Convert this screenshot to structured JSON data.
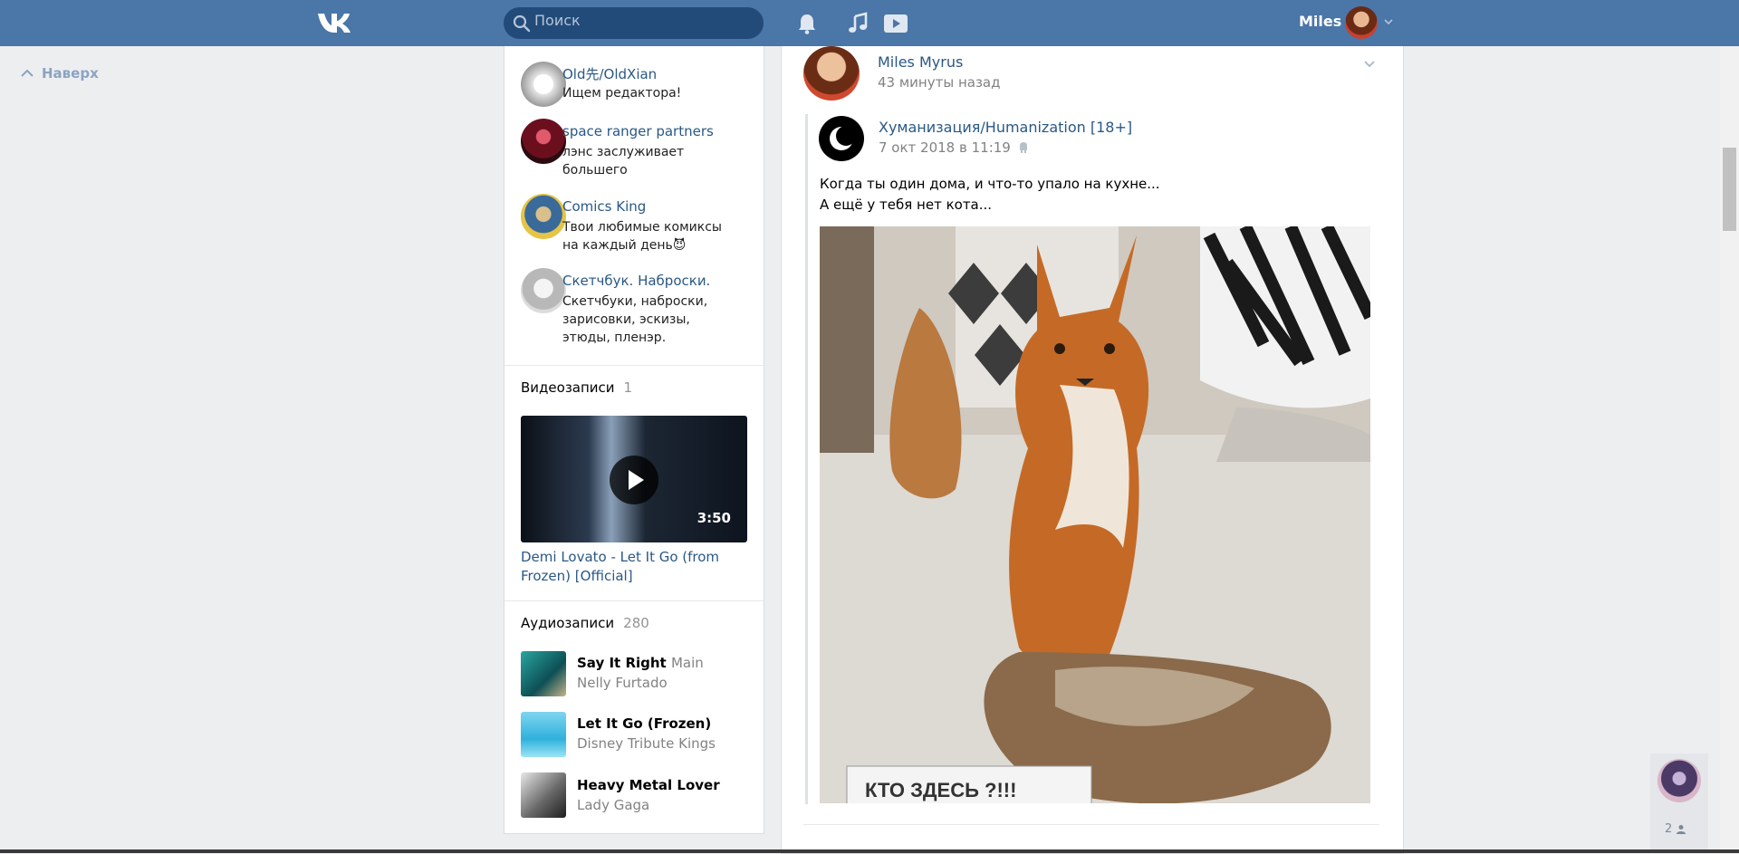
{
  "header": {
    "search_placeholder": "Поиск",
    "user_name": "Miles"
  },
  "sidebar_link": {
    "up_label": "Наверх"
  },
  "groups": [
    {
      "title": "Old先/OldXian",
      "desc": "Ищем редактора!"
    },
    {
      "title": "space ranger partners",
      "desc": "лэнс заслуживает большего"
    },
    {
      "title": "Comics King",
      "desc": "Твои любимые комиксы на каждый день😈"
    },
    {
      "title": "Скетчбук. Наброски.",
      "desc": "Скетчбуки, наброски, зарисовки, эскизы, этюды, пленэр."
    }
  ],
  "videos": {
    "title": "Видеозаписи",
    "count": "1",
    "item": {
      "duration": "3:50",
      "title": "Demi Lovato - Let It Go (from Frozen) [Official]"
    }
  },
  "audios": {
    "title": "Аудиозаписи",
    "count": "280",
    "items": [
      {
        "title": "Say It Right",
        "subtitle": "Main",
        "artist": "Nelly Furtado"
      },
      {
        "title": "Let It Go (Frozen)",
        "subtitle": "",
        "artist": "Disney Tribute Kings"
      },
      {
        "title": "Heavy Metal Lover",
        "subtitle": "",
        "artist": "Lady Gaga"
      }
    ]
  },
  "post": {
    "author": "Miles Myrus",
    "time": "43 минуты назад",
    "repost": {
      "author": "Хуманизация/Humanization [18+]",
      "time": "7 окт 2018 в 11:19",
      "text_line1": "Когда ты один дома, и что-то упало на кухне...",
      "text_line2": "А ещё у тебя нет кота...",
      "image_caption": "КТО ЗДЕСЬ ?!!!"
    }
  },
  "chat": {
    "count": "2"
  },
  "colors": {
    "header": "#4a76a8",
    "link": "#2a5885",
    "background": "#edeef0"
  },
  "icons": {
    "logo": "vk-logo-icon",
    "search": "search-icon",
    "notifications": "bell-icon",
    "music": "music-note-icon",
    "video": "video-play-icon",
    "dropdown": "chevron-down-icon",
    "up": "chevron-up-icon",
    "play": "play-icon",
    "person": "person-icon",
    "android": "android-icon"
  }
}
